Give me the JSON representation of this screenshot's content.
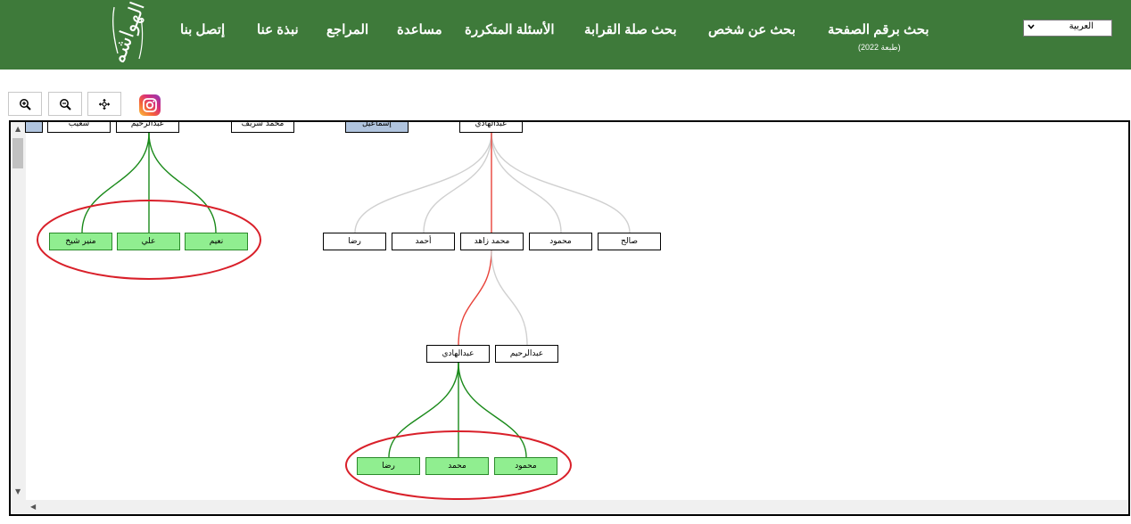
{
  "header": {
    "language_select": "العربية",
    "nav": [
      {
        "id": "page-number",
        "label": "بحث برقم الصفحة"
      },
      {
        "id": "person",
        "label": "بحث عن شخص"
      },
      {
        "id": "kinship",
        "label": "بحث صلة القرابة"
      },
      {
        "id": "faq",
        "label": "الأسئلة المتكررة"
      },
      {
        "id": "help",
        "label": "مساعدة"
      },
      {
        "id": "references",
        "label": "المراجع"
      },
      {
        "id": "about",
        "label": "نبذة عنا"
      },
      {
        "id": "contact",
        "label": "إتصل بنا"
      }
    ],
    "edition": "(طبعة 2022)",
    "logo_text": "الهواشم"
  },
  "toolbar": {
    "zoom_in_icon": "zoom-in-icon",
    "zoom_out_icon": "zoom-out-icon",
    "center_icon": "move-icon",
    "social_icon": "instagram-icon"
  },
  "tree": {
    "top_row": [
      "شعيب",
      "عبدالرحيم",
      "محمد شريف",
      "إسماعيل",
      "عبدالهادي"
    ],
    "left_children": [
      "منير شيخ",
      "علي",
      "نعيم"
    ],
    "mid_children": [
      "رضا",
      "أحمد",
      "محمد زاهد",
      "محمود",
      "صالح"
    ],
    "gen3": [
      "عبدالهادي",
      "عبدالرحيم"
    ],
    "bottom_children": [
      "رضا",
      "محمد",
      "محمود"
    ]
  },
  "colors": {
    "header_green": "#3e7a3a",
    "highlight_node": "#90ee90",
    "selected_node": "#b0c4de",
    "green_link": "#1a8a1a",
    "red_link": "#e8433a",
    "gray_link": "#d0d0d0",
    "circle": "#d9202a"
  }
}
